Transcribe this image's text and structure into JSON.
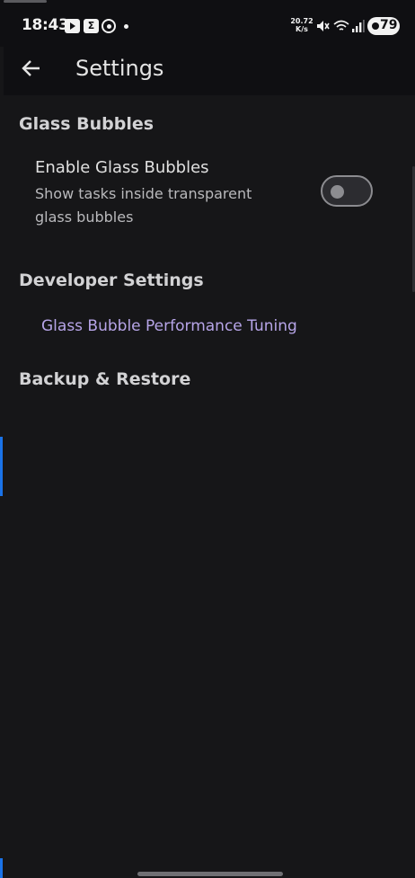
{
  "status_bar": {
    "time": "18:43",
    "notification_icons": [
      "youtube-icon",
      "sigma-app-icon",
      "whatsapp-icon",
      "dot-icon"
    ],
    "net_speed_value": "20.72",
    "net_speed_unit": "K/s",
    "system_icons": [
      "mute-icon",
      "wifi-icon",
      "signal-icon"
    ],
    "battery": "79"
  },
  "app_bar": {
    "back_icon": "arrow-left-icon",
    "title": "Settings"
  },
  "sections": {
    "glass_bubbles": {
      "header": "Glass Bubbles",
      "enable_title": "Enable Glass Bubbles",
      "enable_description": "Show tasks inside transparent glass bubbles",
      "toggle_on": false
    },
    "developer": {
      "header": "Developer Settings",
      "link_label": "Glass Bubble Performance Tuning"
    },
    "backup": {
      "header": "Backup & Restore"
    }
  },
  "colors": {
    "background": "#161618",
    "app_bar": "#0f0f12",
    "link": "#b7a5e8",
    "accent_blue": "#1a73e8"
  }
}
